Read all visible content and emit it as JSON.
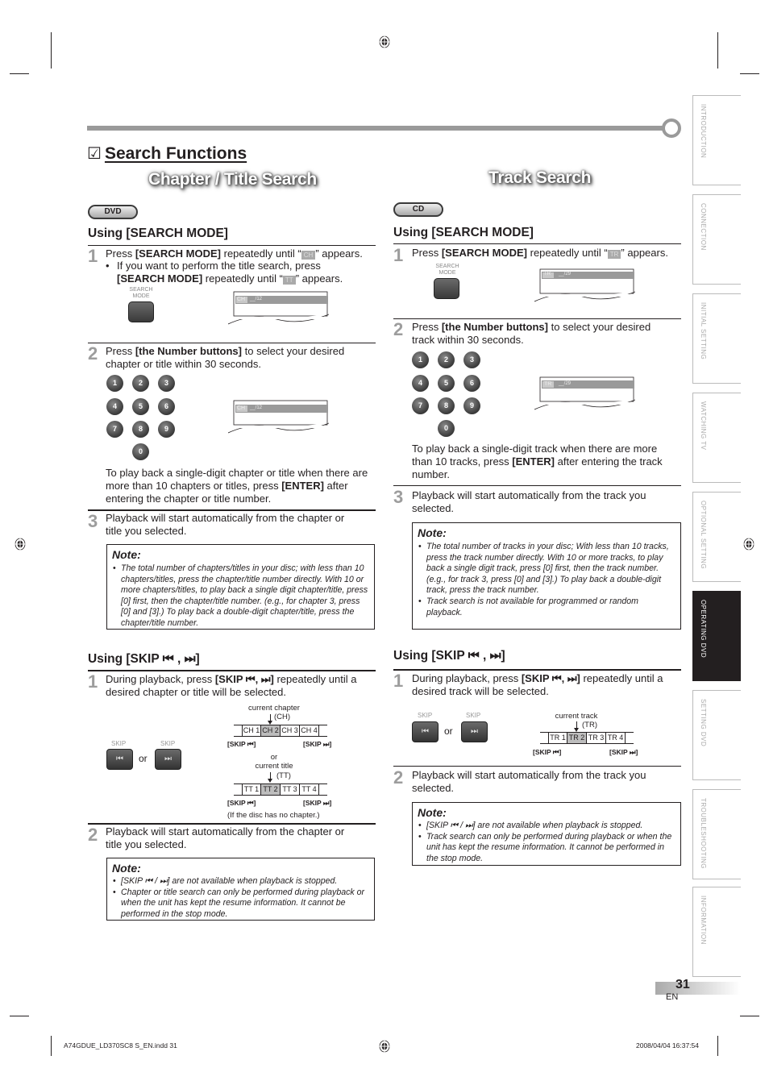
{
  "page": {
    "section_checkbox": "☑",
    "section_title": "Search Functions",
    "page_number": "31",
    "language": "EN",
    "footer_left": "A74GDUE_LD370SC8 S_EN.indd   31",
    "footer_right": "2008/04/04   16:37:54"
  },
  "side_tabs": [
    {
      "label": "INTRODUCTION",
      "active": false
    },
    {
      "label": "CONNECTION",
      "active": false
    },
    {
      "label": "INITIAL  SETTING",
      "active": false
    },
    {
      "label": "WATCHING  TV",
      "active": false
    },
    {
      "label": "OPTIONAL  SETTING",
      "active": false
    },
    {
      "label": "OPERATING  DVD",
      "active": true
    },
    {
      "label": "SETTING  DVD",
      "active": false
    },
    {
      "label": "TROUBLESHOOTING",
      "active": false
    },
    {
      "label": "INFORMATION",
      "active": false
    }
  ],
  "left": {
    "title": "Chapter / Title Search",
    "disc_badge": "DVD",
    "search_mode": {
      "heading": "Using [SEARCH MODE]",
      "step1": {
        "num": "1",
        "pre": "Press ",
        "bold": "[SEARCH MODE]",
        "post": " repeatedly until “",
        "icon": "CH",
        "end": "” appears.",
        "bullet_pre": "If you want to perform the title search, press",
        "bullet_bold": "[SEARCH MODE]",
        "bullet_post": " repeatedly until “",
        "bullet_icon": "TT",
        "bullet_end": "” appears.",
        "button_label": "SEARCH MODE",
        "screen_tag": "CH",
        "screen_value": "__/12"
      },
      "step2": {
        "num": "2",
        "pre": "Press ",
        "bold": "[the Number buttons]",
        "post": " to select your desired chapter or title within 30 seconds.",
        "keys": [
          "1",
          "2",
          "3",
          "4",
          "5",
          "6",
          "7",
          "8",
          "9",
          "0"
        ],
        "screen_tag": "CH",
        "screen_value": "__/12",
        "tip_pre": "To play back a single-digit chapter or title when there are more than 10 chapters or titles, press ",
        "tip_bold": "[ENTER]",
        "tip_post": " after entering the chapter or title number."
      },
      "step3": {
        "num": "3",
        "text": "Playback will start automatically from the chapter or title you selected."
      },
      "note": {
        "title": "Note:",
        "items": [
          "The total number of chapters/titles in your disc; with less than 10 chapters/titles, press the chapter/title number directly. With 10 or more chapters/titles, to play back a single digit chapter/title, press [0] first, then the chapter/title number. (e.g., for chapter 3, press [0] and [3].) To play back a double-digit chapter/title, press the chapter/title number."
        ]
      }
    },
    "skip": {
      "heading": "Using [SKIP ⏮ , ⏭]",
      "step1": {
        "num": "1",
        "pre": "During playback, press ",
        "bold": "[SKIP ⏮, ⏭]",
        "post": " repeatedly until a desired chapter or title will be selected.",
        "skip_label": "SKIP",
        "or": "or",
        "chapter_caption": "current chapter",
        "chapter_abbr": "(CH)",
        "chapters": [
          "CH 1",
          "CH 2",
          "CH 3",
          "CH 4"
        ],
        "current_chapter_index": 1,
        "skip_prev": "[SKIP ⏮]",
        "skip_next": "[SKIP ⏭]",
        "or_mid": "or",
        "title_caption": "current title",
        "title_abbr": "(TT)",
        "titles": [
          "TT 1",
          "TT 2",
          "TT 3",
          "TT 4"
        ],
        "current_title_index": 1,
        "no_chapter_note": "(If the disc has no chapter.)"
      },
      "step2": {
        "num": "2",
        "text": "Playback will start automatically from the chapter or title you selected."
      },
      "note": {
        "title": "Note:",
        "items": [
          "[SKIP ⏮ / ⏭] are not available when playback is stopped.",
          "Chapter or title search can only be performed during playback or when the unit has kept the resume information. It cannot be performed in the stop mode."
        ]
      }
    }
  },
  "right": {
    "title": "Track Search",
    "disc_badge": "CD",
    "search_mode": {
      "heading": "Using [SEARCH MODE]",
      "step1": {
        "num": "1",
        "pre": "Press ",
        "bold": "[SEARCH MODE]",
        "post": " repeatedly until “",
        "icon": "TR",
        "end": "” appears.",
        "button_label": "SEARCH MODE",
        "screen_tag": "TR",
        "screen_value": "__/29"
      },
      "step2": {
        "num": "2",
        "pre": "Press ",
        "bold": "[the Number buttons]",
        "post": " to select your desired track within 30 seconds.",
        "keys": [
          "1",
          "2",
          "3",
          "4",
          "5",
          "6",
          "7",
          "8",
          "9",
          "0"
        ],
        "screen_tag": "TR",
        "screen_value": "__/29",
        "tip_pre": "To play back a single-digit track when there are more than 10 tracks, press ",
        "tip_bold": "[ENTER]",
        "tip_post": " after entering the track number."
      },
      "step3": {
        "num": "3",
        "text": "Playback will start automatically from the track you selected."
      },
      "note": {
        "title": "Note:",
        "items": [
          "The total number of tracks in your disc; With less than 10 tracks, press the track number directly. With 10 or more tracks, to play back a single digit track, press [0] first, then the track number. (e.g., for track 3, press [0] and [3].) To play back a double-digit track, press the track number.",
          "Track search is not available for programmed or random playback."
        ]
      }
    },
    "skip": {
      "heading": "Using [SKIP ⏮ , ⏭]",
      "step1": {
        "num": "1",
        "pre": "During playback, press ",
        "bold": "[SKIP ⏮, ⏭]",
        "post": " repeatedly until a desired track will be selected.",
        "skip_label": "SKIP",
        "or": "or",
        "track_caption": "current track",
        "track_abbr": "(TR)",
        "tracks": [
          "TR 1",
          "TR 2",
          "TR 3",
          "TR 4"
        ],
        "current_track_index": 1,
        "skip_prev": "[SKIP ⏮]",
        "skip_next": "[SKIP ⏭]"
      },
      "step2": {
        "num": "2",
        "text": "Playback will start automatically from the track you selected."
      },
      "note": {
        "title": "Note:",
        "items": [
          "[SKIP ⏮ / ⏭] are not available when playback is stopped.",
          "Track search can only be performed during playback or when the unit has kept the resume information. It cannot be performed in the stop mode."
        ]
      }
    }
  }
}
